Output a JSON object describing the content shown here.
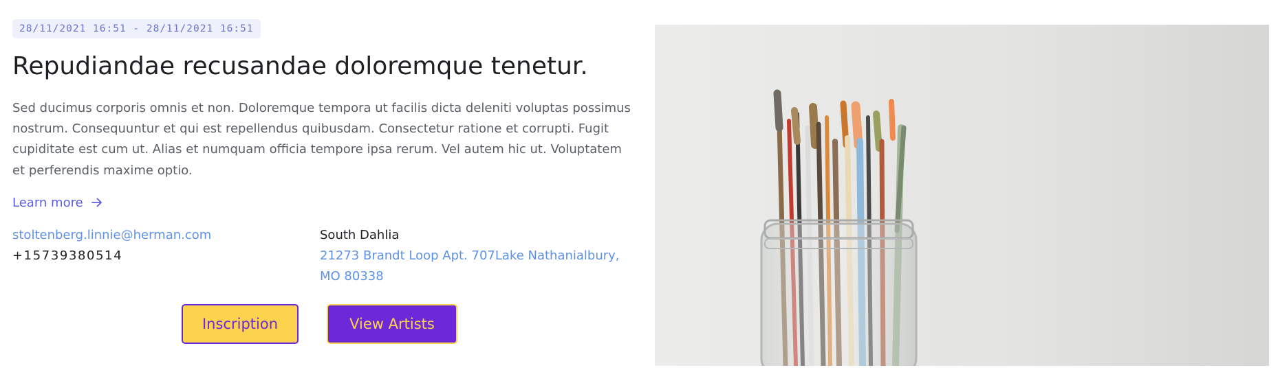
{
  "event": {
    "date_range": "28/11/2021 16:51 - 28/11/2021 16:51",
    "title": "Repudiandae recusandae doloremque tenetur.",
    "description": "Sed ducimus corporis omnis et non. Doloremque tempora ut facilis dicta deleniti voluptas possimus nostrum. Consequuntur et qui est repellendus quibusdam. Consectetur ratione et corrupti. Fugit cupiditate est cum ut. Alias et numquam officia tempore ipsa rerum. Vel autem hic ut. Voluptatem et perferendis maxime optio.",
    "learn_more_label": "Learn more"
  },
  "contact": {
    "email": "stoltenberg.linnie@herman.com",
    "phone": "+15739380514"
  },
  "address": {
    "city": "South Dahlia",
    "street": "21273 Brandt Loop Apt. 707Lake Nathanialbury, MO 80338"
  },
  "actions": {
    "inscription_label": "Inscription",
    "view_artists_label": "View Artists"
  },
  "icons": {
    "learn_more": "arrow-right-icon"
  },
  "colors": {
    "accent_purple": "#6d28d9",
    "accent_yellow": "#fcd34d",
    "link_blue": "#5f92e6",
    "learn_more": "#5b5fdb",
    "badge_bg": "#eef0fb"
  }
}
